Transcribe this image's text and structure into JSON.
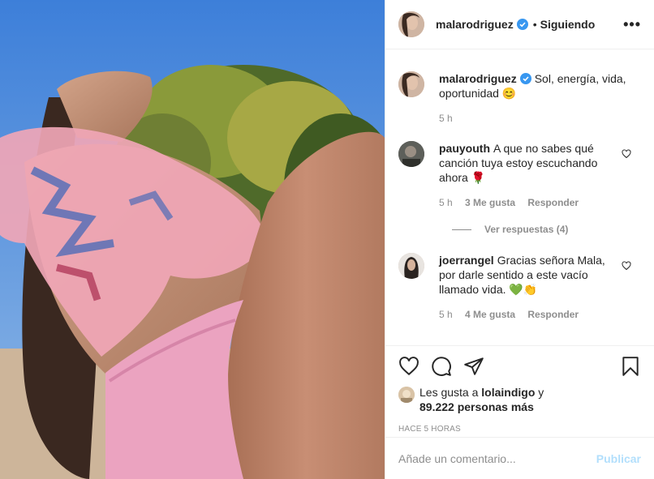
{
  "post": {
    "author": "malarodriguez",
    "follow_dot": "•",
    "follow_status": "Siguiendo",
    "more_label": "•••"
  },
  "caption": {
    "username": "malarodriguez",
    "text": "Sol, energía, vida, oportunidad 😊",
    "time": "5 h"
  },
  "comments": [
    {
      "username": "pauyouth",
      "text": "A que no sabes qué canción tuya estoy escuchando ahora 🌹",
      "time": "5 h",
      "likes": "3 Me gusta",
      "reply": "Responder",
      "view_replies": "Ver respuestas (4)"
    },
    {
      "username": "joerrangel",
      "text": "Gracias señora Mala, por darle sentido a este vacío llamado vida. 💚👏",
      "time": "5 h",
      "likes": "4 Me gusta",
      "reply": "Responder"
    }
  ],
  "likes_line": {
    "prefix": "Les gusta a",
    "user": "lolaindigo",
    "joiner": "y",
    "count": "89.222 personas más"
  },
  "post_time": "HACE 5 HORAS",
  "comment_box": {
    "placeholder": "Añade un comentario...",
    "publish": "Publicar"
  },
  "colors": {
    "sky": "#4a86d6",
    "verified": "#3897f0",
    "publish_disabled": "#b2dffc",
    "muted": "#8e8e8e"
  },
  "icons": [
    "heart-icon",
    "comment-icon",
    "share-icon",
    "bookmark-icon",
    "verified-icon",
    "more-icon"
  ]
}
